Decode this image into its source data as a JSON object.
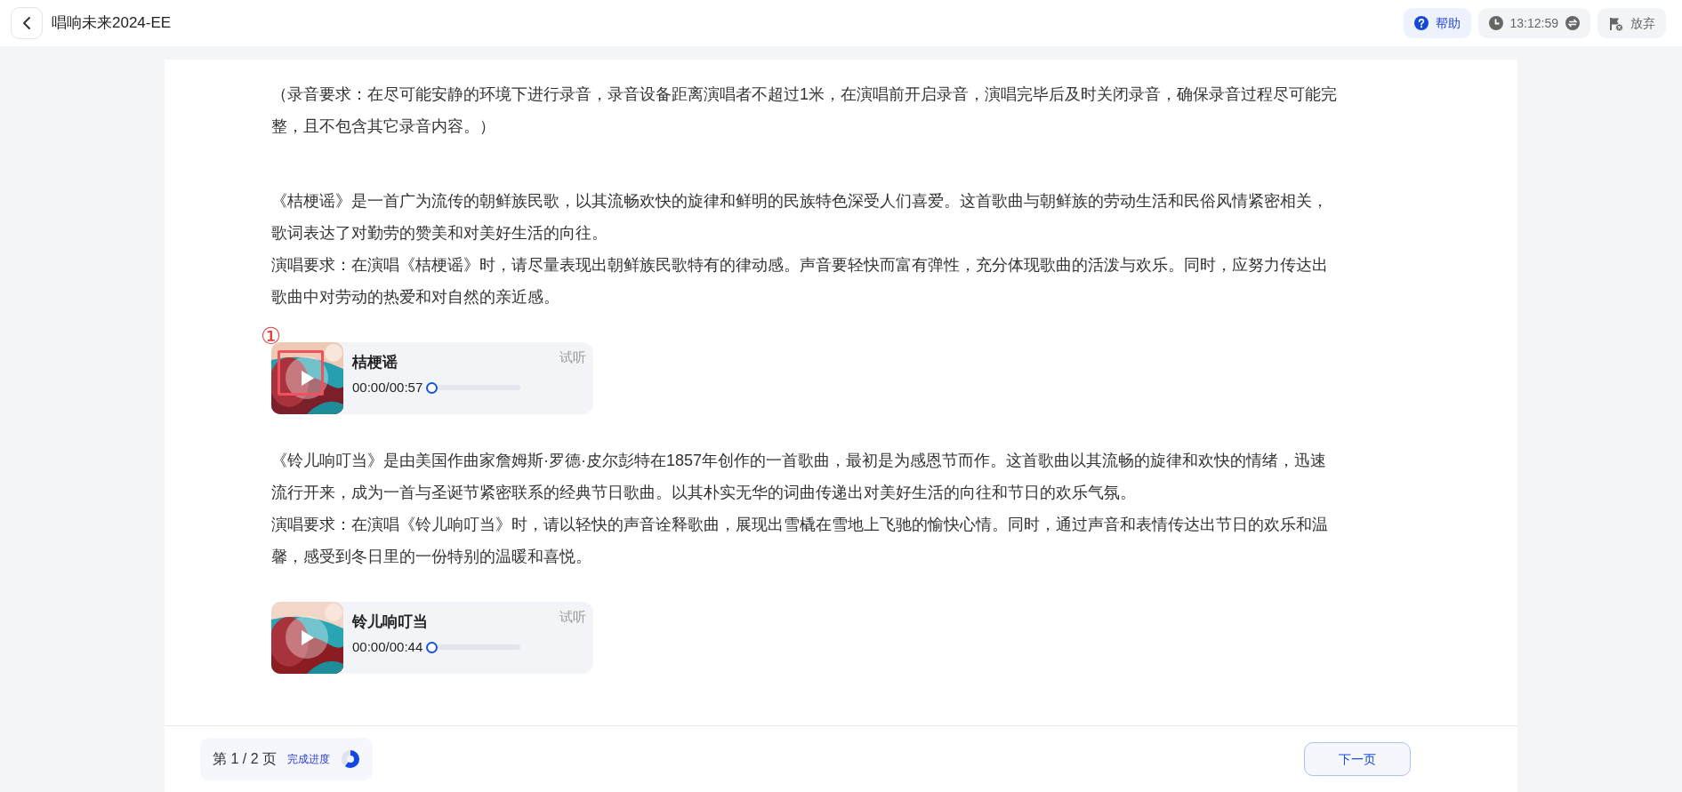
{
  "header": {
    "title": "唱响未来2024-EE",
    "help": "帮助",
    "timer": "13:12:59",
    "abandon": "放弃"
  },
  "intro": "（录音要求：在尽可能安静的环境下进行录音，录音设备距离演唱者不超过1米，在演唱前开启录音，演唱完毕后及时关闭录音，确保录音过程尽可能完整，且不包含其它录音内容。）",
  "sections": [
    {
      "description": "《桔梗谣》是一首广为流传的朝鲜族民歌，以其流畅欢快的旋律和鲜明的民族特色深受人们喜爱。这首歌曲与朝鲜族的劳动生活和民俗风情紧密相关，歌词表达了对勤劳的赞美和对美好生活的向往。",
      "requirement": "演唱要求：在演唱《桔梗谣》时，请尽量表现出朝鲜族民歌特有的律动感。声音要轻快而富有弹性，充分体现歌曲的活泼与欢乐。同时，应努力传达出歌曲中对劳动的热爱和对自然的亲近感。",
      "audio": {
        "title": "桔梗谣",
        "time": "00:00/00:57",
        "preview": "试听",
        "annotation": "①"
      }
    },
    {
      "description": "《铃儿响叮当》是由美国作曲家詹姆斯·罗德·皮尔彭特在1857年创作的一首歌曲，最初是为感恩节而作。这首歌曲以其流畅的旋律和欢快的情绪，迅速流行开来，成为一首与圣诞节紧密联系的经典节日歌曲。以其朴实无华的词曲传递出对美好生活的向往和节日的欢乐气氛。",
      "requirement": "演唱要求：在演唱《铃儿响叮当》时，请以轻快的声音诠释歌曲，展现出雪橇在雪地上飞驰的愉快心情。同时，通过声音和表情传达出节日的欢乐和温馨，感受到冬日里的一份特别的温暖和喜悦。",
      "audio": {
        "title": "铃儿响叮当",
        "time": "00:00/00:44",
        "preview": "试听"
      }
    }
  ],
  "footer": {
    "page": "第 1 / 2 页",
    "progress_label": "完成进度",
    "next": "下一页"
  }
}
